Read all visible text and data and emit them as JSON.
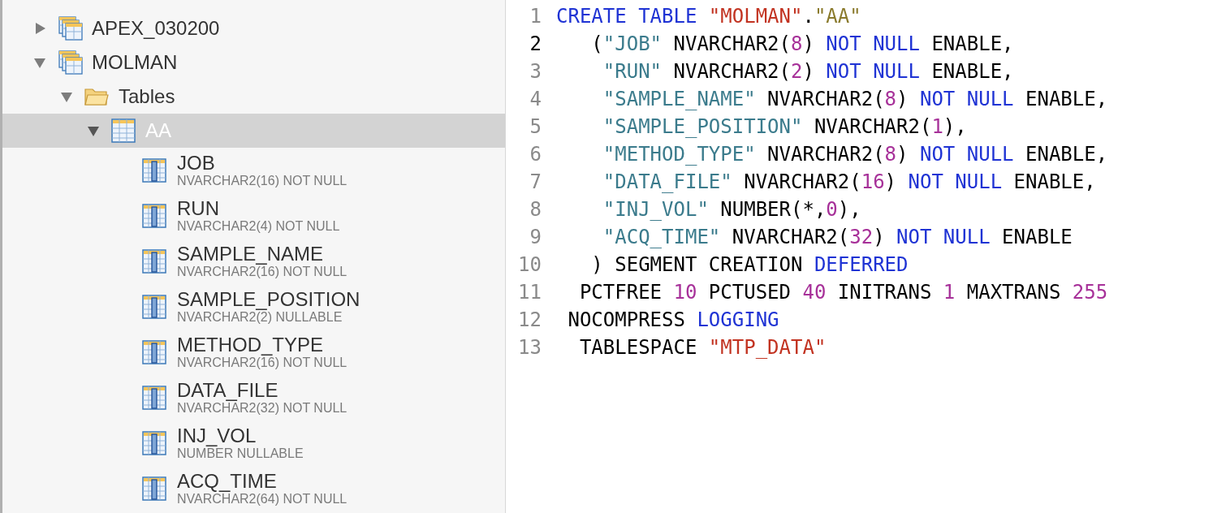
{
  "tree": [
    {
      "label": "APEX_030200",
      "kind": "schema",
      "expanded": false,
      "selected": false
    },
    {
      "label": "MOLMAN",
      "kind": "schema",
      "expanded": true,
      "selected": false,
      "children": [
        {
          "label": "Tables",
          "kind": "folder",
          "expanded": true,
          "selected": false,
          "children": [
            {
              "label": "AA",
              "kind": "table",
              "expanded": true,
              "selected": true,
              "children": [
                {
                  "label": "JOB",
                  "kind": "column",
                  "type": "NVARCHAR2(16) NOT NULL"
                },
                {
                  "label": "RUN",
                  "kind": "column",
                  "type": "NVARCHAR2(4) NOT NULL"
                },
                {
                  "label": "SAMPLE_NAME",
                  "kind": "column",
                  "type": "NVARCHAR2(16) NOT NULL"
                },
                {
                  "label": "SAMPLE_POSITION",
                  "kind": "column",
                  "type": "NVARCHAR2(2) NULLABLE"
                },
                {
                  "label": "METHOD_TYPE",
                  "kind": "column",
                  "type": "NVARCHAR2(16) NOT NULL"
                },
                {
                  "label": "DATA_FILE",
                  "kind": "column",
                  "type": "NVARCHAR2(32) NOT NULL"
                },
                {
                  "label": "INJ_VOL",
                  "kind": "column",
                  "type": "NUMBER NULLABLE"
                },
                {
                  "label": "ACQ_TIME",
                  "kind": "column",
                  "type": "NVARCHAR2(64) NOT NULL"
                }
              ]
            }
          ]
        }
      ]
    }
  ],
  "editor": {
    "lines": [
      {
        "number": "1",
        "current": false,
        "tokens": [
          {
            "kind": "keyword",
            "text": "CREATE TABLE "
          },
          {
            "kind": "schema",
            "text": "\"MOLMAN\""
          },
          {
            "kind": "plain",
            "text": "."
          },
          {
            "kind": "table",
            "text": "\"AA\""
          }
        ]
      },
      {
        "number": "2",
        "current": true,
        "tokens": [
          {
            "kind": "plain",
            "text": "   ("
          },
          {
            "kind": "column",
            "text": "\"JOB\""
          },
          {
            "kind": "plain",
            "text": " NVARCHAR2("
          },
          {
            "kind": "number",
            "text": "8"
          },
          {
            "kind": "plain",
            "text": ") "
          },
          {
            "kind": "keyword",
            "text": "NOT NULL"
          },
          {
            "kind": "plain",
            "text": " ENABLE,"
          }
        ]
      },
      {
        "number": "3",
        "current": false,
        "tokens": [
          {
            "kind": "column",
            "text": "    \"RUN\""
          },
          {
            "kind": "plain",
            "text": " NVARCHAR2("
          },
          {
            "kind": "number",
            "text": "2"
          },
          {
            "kind": "plain",
            "text": ") "
          },
          {
            "kind": "keyword",
            "text": "NOT NULL"
          },
          {
            "kind": "plain",
            "text": " ENABLE,"
          }
        ]
      },
      {
        "number": "4",
        "current": false,
        "tokens": [
          {
            "kind": "column",
            "text": "    \"SAMPLE_NAME\""
          },
          {
            "kind": "plain",
            "text": " NVARCHAR2("
          },
          {
            "kind": "number",
            "text": "8"
          },
          {
            "kind": "plain",
            "text": ") "
          },
          {
            "kind": "keyword",
            "text": "NOT NULL"
          },
          {
            "kind": "plain",
            "text": " ENABLE,"
          }
        ]
      },
      {
        "number": "5",
        "current": false,
        "tokens": [
          {
            "kind": "column",
            "text": "    \"SAMPLE_POSITION\""
          },
          {
            "kind": "plain",
            "text": " NVARCHAR2("
          },
          {
            "kind": "number",
            "text": "1"
          },
          {
            "kind": "plain",
            "text": "),"
          }
        ]
      },
      {
        "number": "6",
        "current": false,
        "tokens": [
          {
            "kind": "column",
            "text": "    \"METHOD_TYPE\""
          },
          {
            "kind": "plain",
            "text": " NVARCHAR2("
          },
          {
            "kind": "number",
            "text": "8"
          },
          {
            "kind": "plain",
            "text": ") "
          },
          {
            "kind": "keyword",
            "text": "NOT NULL"
          },
          {
            "kind": "plain",
            "text": " ENABLE,"
          }
        ]
      },
      {
        "number": "7",
        "current": false,
        "tokens": [
          {
            "kind": "column",
            "text": "    \"DATA_FILE\""
          },
          {
            "kind": "plain",
            "text": " NVARCHAR2("
          },
          {
            "kind": "number",
            "text": "16"
          },
          {
            "kind": "plain",
            "text": ") "
          },
          {
            "kind": "keyword",
            "text": "NOT NULL"
          },
          {
            "kind": "plain",
            "text": " ENABLE,"
          }
        ]
      },
      {
        "number": "8",
        "current": false,
        "tokens": [
          {
            "kind": "column",
            "text": "    \"INJ_VOL\""
          },
          {
            "kind": "plain",
            "text": " NUMBER(*,"
          },
          {
            "kind": "number",
            "text": "0"
          },
          {
            "kind": "plain",
            "text": "),"
          }
        ]
      },
      {
        "number": "9",
        "current": false,
        "tokens": [
          {
            "kind": "column",
            "text": "    \"ACQ_TIME\""
          },
          {
            "kind": "plain",
            "text": " NVARCHAR2("
          },
          {
            "kind": "number",
            "text": "32"
          },
          {
            "kind": "plain",
            "text": ") "
          },
          {
            "kind": "keyword",
            "text": "NOT NULL"
          },
          {
            "kind": "plain",
            "text": " ENABLE"
          }
        ]
      },
      {
        "number": "10",
        "current": false,
        "tokens": [
          {
            "kind": "plain",
            "text": "   ) SEGMENT CREATION "
          },
          {
            "kind": "keyword",
            "text": "DEFERRED"
          }
        ]
      },
      {
        "number": "11",
        "current": false,
        "tokens": [
          {
            "kind": "plain",
            "text": "  PCTFREE "
          },
          {
            "kind": "number",
            "text": "10"
          },
          {
            "kind": "plain",
            "text": " PCTUSED "
          },
          {
            "kind": "number",
            "text": "40"
          },
          {
            "kind": "plain",
            "text": " INITRANS "
          },
          {
            "kind": "number",
            "text": "1"
          },
          {
            "kind": "plain",
            "text": " MAXTRANS "
          },
          {
            "kind": "number",
            "text": "255"
          }
        ]
      },
      {
        "number": "12",
        "current": false,
        "tokens": [
          {
            "kind": "plain",
            "text": " NOCOMPRESS "
          },
          {
            "kind": "keyword",
            "text": "LOGGING"
          }
        ]
      },
      {
        "number": "13",
        "current": false,
        "tokens": [
          {
            "kind": "plain",
            "text": "  TABLESPACE "
          },
          {
            "kind": "schema",
            "text": "\"MTP_DATA\""
          }
        ]
      }
    ]
  }
}
